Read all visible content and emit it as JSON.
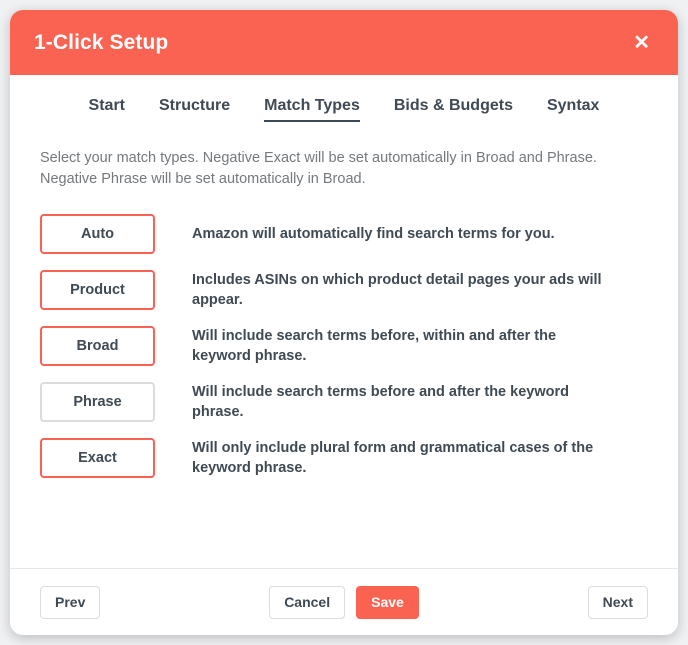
{
  "modal": {
    "title": "1-Click Setup",
    "close_icon": "close-icon",
    "close_glyph": "✕",
    "accent_color": "#fa6252",
    "text_color": "#3f4a54",
    "muted_text_color": "#74797e",
    "unselected_border_color": "#dcdcdc"
  },
  "tabs": [
    {
      "label": "Start",
      "active": false
    },
    {
      "label": "Structure",
      "active": false
    },
    {
      "label": "Match Types",
      "active": true
    },
    {
      "label": "Bids & Budgets",
      "active": false
    },
    {
      "label": "Syntax",
      "active": false
    }
  ],
  "content": {
    "intro": "Select your match types. Negative Exact will be set automatically in Broad and Phrase. Negative Phrase will be set automatically in Broad.",
    "match_types": [
      {
        "label": "Auto",
        "selected": true,
        "description": "Amazon will automatically find search terms for you."
      },
      {
        "label": "Product",
        "selected": true,
        "description": "Includes ASINs on which product detail pages your ads will appear."
      },
      {
        "label": "Broad",
        "selected": true,
        "description": "Will include search terms before, within and after the keyword phrase."
      },
      {
        "label": "Phrase",
        "selected": false,
        "description": "Will include search terms before and after the keyword phrase."
      },
      {
        "label": "Exact",
        "selected": true,
        "description": "Will only include plural form and grammatical cases of the keyword phrase."
      }
    ]
  },
  "footer": {
    "prev_label": "Prev",
    "cancel_label": "Cancel",
    "save_label": "Save",
    "next_label": "Next"
  }
}
